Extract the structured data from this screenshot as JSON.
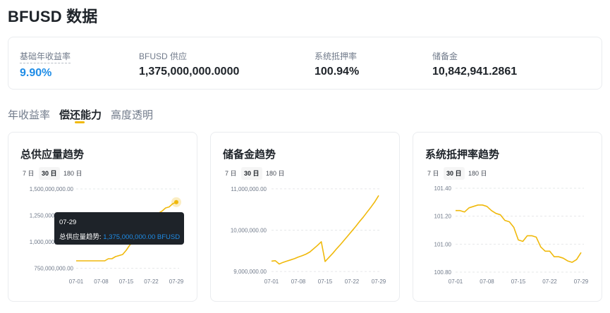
{
  "page": {
    "title": "BFUSD 数据"
  },
  "stats": [
    {
      "label": "基础年收益率",
      "value": "9.90%"
    },
    {
      "label": "BFUSD 供应",
      "value": "1,375,000,000.0000"
    },
    {
      "label": "系统抵押率",
      "value": "100.94%"
    },
    {
      "label": "储备金",
      "value": "10,842,941.2861"
    }
  ],
  "tabs": [
    {
      "label": "年收益率"
    },
    {
      "label": "偿还能力"
    },
    {
      "label": "高度透明"
    }
  ],
  "active_tab": "偿还能力",
  "range_options": [
    "7 日",
    "30 日",
    "180 日"
  ],
  "selected_range": "30 日",
  "accent_color": "#f0b90b",
  "value_color": "#1e8ce6",
  "cards": [
    {
      "title": "总供应量趋势"
    },
    {
      "title": "储备金趋势"
    },
    {
      "title": "系统抵押率趋势"
    }
  ],
  "tooltip": {
    "date": "07-29",
    "label": "总供应量趋势:",
    "value": "1,375,000,000.00 BFUSD"
  },
  "chart_data": [
    {
      "type": "line",
      "title": "总供应量趋势",
      "x": [
        "07-01",
        "07-02",
        "07-03",
        "07-04",
        "07-05",
        "07-06",
        "07-07",
        "07-08",
        "07-09",
        "07-10",
        "07-11",
        "07-12",
        "07-13",
        "07-14",
        "07-15",
        "07-16",
        "07-17",
        "07-18",
        "07-19",
        "07-20",
        "07-21",
        "07-22",
        "07-23",
        "07-24",
        "07-25",
        "07-26",
        "07-27",
        "07-28",
        "07-29"
      ],
      "values": [
        820000000,
        820000000,
        820000000,
        820000000,
        820000000,
        820000000,
        820000000,
        820000000,
        820000000,
        840000000,
        840000000,
        860000000,
        870000000,
        880000000,
        920000000,
        970000000,
        1000000000,
        1040000000,
        1080000000,
        1110000000,
        1140000000,
        1180000000,
        1230000000,
        1270000000,
        1290000000,
        1320000000,
        1330000000,
        1360000000,
        1375000000
      ],
      "x_ticks": [
        "07-01",
        "07-08",
        "07-15",
        "07-22",
        "07-29"
      ],
      "y_ticks": [
        750000000,
        1000000000,
        1250000000,
        1500000000
      ],
      "y_tick_labels": [
        "750,000,000.00",
        "1,000,000,000.00",
        "1,250,000,000.00",
        "1,500,000,000.00"
      ],
      "ylim": [
        700000000,
        1520000000
      ],
      "highlight_x": "07-29",
      "grid": "horizontal dashed"
    },
    {
      "type": "line",
      "title": "储备金趋势",
      "x": [
        "07-01",
        "07-02",
        "07-03",
        "07-04",
        "07-05",
        "07-06",
        "07-07",
        "07-08",
        "07-09",
        "07-10",
        "07-11",
        "07-12",
        "07-13",
        "07-14",
        "07-15",
        "07-16",
        "07-17",
        "07-18",
        "07-19",
        "07-20",
        "07-21",
        "07-22",
        "07-23",
        "07-24",
        "07-25",
        "07-26",
        "07-27",
        "07-28",
        "07-29"
      ],
      "values": [
        9250000,
        9260000,
        9180000,
        9220000,
        9250000,
        9280000,
        9310000,
        9350000,
        9380000,
        9420000,
        9470000,
        9550000,
        9630000,
        9720000,
        9240000,
        9340000,
        9440000,
        9550000,
        9650000,
        9760000,
        9870000,
        9980000,
        10090000,
        10210000,
        10320000,
        10440000,
        10560000,
        10690000,
        10840000
      ],
      "x_ticks": [
        "07-01",
        "07-08",
        "07-15",
        "07-22",
        "07-29"
      ],
      "y_ticks": [
        9000000,
        10000000,
        11000000
      ],
      "y_tick_labels": [
        "9,000,000.00",
        "10,000,000.00",
        "11,000,000.00"
      ],
      "ylim": [
        8950000,
        11050000
      ],
      "grid": "horizontal dashed"
    },
    {
      "type": "line",
      "title": "系统抵押率趋势",
      "x": [
        "07-01",
        "07-02",
        "07-03",
        "07-04",
        "07-05",
        "07-06",
        "07-07",
        "07-08",
        "07-09",
        "07-10",
        "07-11",
        "07-12",
        "07-13",
        "07-14",
        "07-15",
        "07-16",
        "07-17",
        "07-18",
        "07-19",
        "07-20",
        "07-21",
        "07-22",
        "07-23",
        "07-24",
        "07-25",
        "07-26",
        "07-27",
        "07-28",
        "07-29"
      ],
      "values": [
        101.24,
        101.24,
        101.23,
        101.26,
        101.27,
        101.28,
        101.28,
        101.27,
        101.24,
        101.22,
        101.21,
        101.17,
        101.16,
        101.12,
        101.03,
        101.02,
        101.06,
        101.06,
        101.05,
        100.98,
        100.95,
        100.95,
        100.91,
        100.91,
        100.9,
        100.88,
        100.87,
        100.89,
        100.94
      ],
      "x_ticks": [
        "07-01",
        "07-08",
        "07-15",
        "07-22",
        "07-29"
      ],
      "y_ticks": [
        100.8,
        101.0,
        101.2,
        101.4
      ],
      "y_tick_labels": [
        "100.80",
        "101.00",
        "101.20",
        "101.40"
      ],
      "ylim": [
        100.79,
        101.41
      ],
      "grid": "horizontal dashed"
    }
  ]
}
